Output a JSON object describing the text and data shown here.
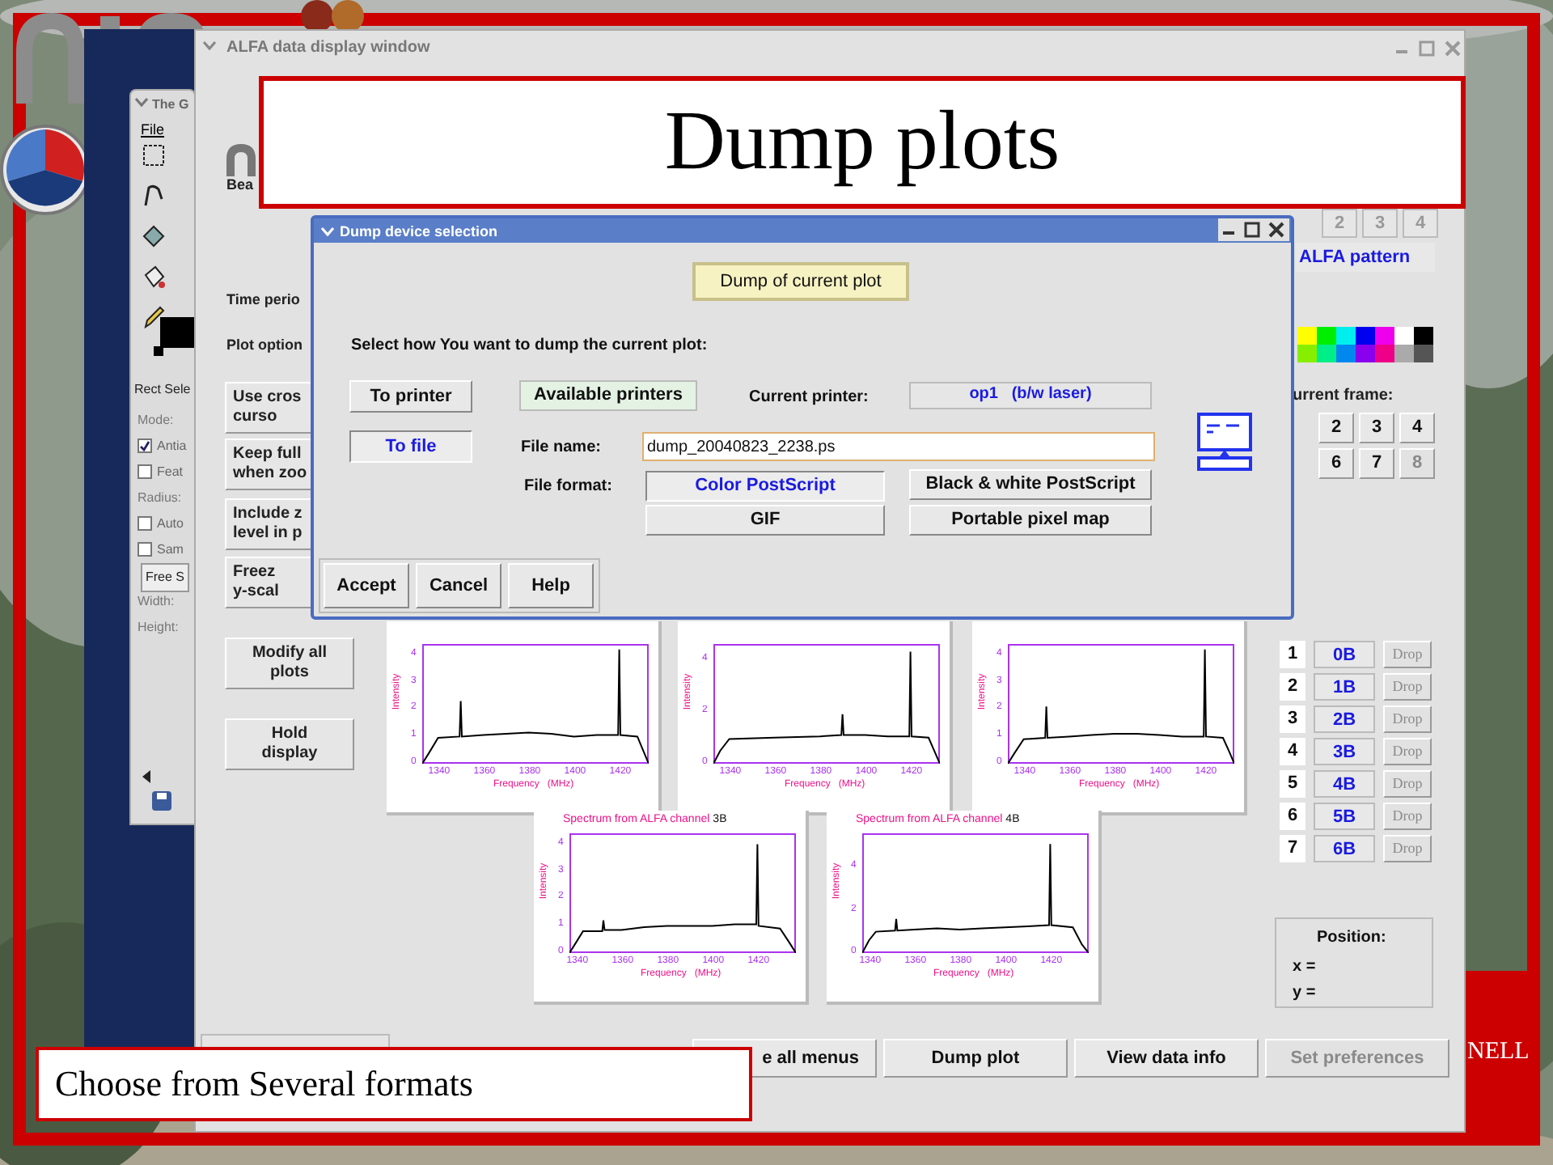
{
  "slide": {
    "title": "Dump plots",
    "caption": "Choose from Several formats",
    "corner_text": "NELL"
  },
  "toolbox": {
    "title": "The G",
    "menu": [
      "File"
    ],
    "panel_title": "Rect Sele",
    "options": [
      {
        "kind": "label",
        "label": "Mode:"
      },
      {
        "kind": "checkbox",
        "label": "Antia",
        "checked": true
      },
      {
        "kind": "checkbox",
        "label": "Feat",
        "checked": false
      },
      {
        "kind": "label",
        "label": "Radius:"
      },
      {
        "kind": "checkbox",
        "label": "Auto",
        "checked": false
      },
      {
        "kind": "checkbox",
        "label": "Sam",
        "checked": false
      },
      {
        "kind": "dropdown",
        "label": "Free S"
      },
      {
        "kind": "label",
        "label": "Width:"
      },
      {
        "kind": "label",
        "label": "Height:"
      }
    ]
  },
  "main_window": {
    "title": "ALFA data display window",
    "labels": [
      "Bea",
      "Time perio",
      "Plot option"
    ],
    "side_buttons": [
      "Use cros\ncurso",
      "Keep full\nwhen zoo",
      "Include z\nlevel in p",
      "Freez\ny-scal",
      "Modify all\nplots",
      "Hold\ndisplay"
    ],
    "beam_buttons": [
      "2",
      "3",
      "4"
    ],
    "pattern_button": "ALFA pattern",
    "frame_label": "urrent frame:",
    "frame_buttons": [
      {
        "label": "2",
        "disabled": false
      },
      {
        "label": "3",
        "disabled": false
      },
      {
        "label": "4",
        "disabled": false
      },
      {
        "label": "6",
        "disabled": false
      },
      {
        "label": "7",
        "disabled": false
      },
      {
        "label": "8",
        "disabled": true
      }
    ],
    "channels": [
      {
        "number": "1",
        "beam": "0B",
        "drop": "Drop",
        "drop_disabled": true
      },
      {
        "number": "2",
        "beam": "1B",
        "drop": "Drop",
        "drop_disabled": true
      },
      {
        "number": "3",
        "beam": "2B",
        "drop": "Drop",
        "drop_disabled": true
      },
      {
        "number": "4",
        "beam": "3B",
        "drop": "Drop",
        "drop_disabled": true
      },
      {
        "number": "5",
        "beam": "4B",
        "drop": "Drop",
        "drop_disabled": true
      },
      {
        "number": "6",
        "beam": "5B",
        "drop": "Drop",
        "drop_disabled": true
      },
      {
        "number": "7",
        "beam": "6B",
        "drop": "Drop",
        "drop_disabled": true
      }
    ],
    "position": {
      "title": "Position:",
      "x": "x =",
      "y": "y ="
    },
    "bottom_buttons": [
      {
        "label": "e all menus",
        "disabled": false
      },
      {
        "label": "Dump plot",
        "disabled": false
      },
      {
        "label": "View data info",
        "disabled": false
      },
      {
        "label": "Set preferences",
        "disabled": true
      }
    ],
    "plots": [
      {
        "chart_data": {
          "type": "line",
          "xlabel": "Frequency   (MHz)",
          "ylabel": "Intensity",
          "xlim": [
            1333,
            1433
          ],
          "ylim": [
            0,
            4.4
          ],
          "xticks": [
            1340,
            1360,
            1380,
            1400,
            1420
          ],
          "yticks": [
            0,
            1,
            2,
            3,
            4
          ],
          "x": [
            1333,
            1336,
            1340,
            1349.5,
            1350,
            1350.5,
            1360,
            1370,
            1380,
            1390,
            1400,
            1410,
            1419.5,
            1420,
            1420.5,
            1428,
            1431,
            1433
          ],
          "series": [
            {
              "color": "#000000",
              "values": [
                0,
                0.4,
                0.95,
                1.0,
                2.3,
                1.0,
                1.05,
                1.1,
                1.15,
                1.1,
                1.0,
                1.05,
                1.05,
                4.2,
                1.05,
                1.0,
                0.4,
                0
              ]
            }
          ]
        }
      },
      {
        "chart_data": {
          "type": "line",
          "xlabel": "Frequency   (MHz)",
          "ylabel": "Intensity",
          "xlim": [
            1333,
            1433
          ],
          "ylim": [
            0,
            4.6
          ],
          "xticks": [
            1340,
            1360,
            1380,
            1400,
            1420
          ],
          "yticks": [
            0,
            2,
            4
          ],
          "x": [
            1333,
            1336,
            1340,
            1360,
            1380,
            1389.5,
            1390,
            1390.5,
            1400,
            1410,
            1419.5,
            1420,
            1420.5,
            1428,
            1431,
            1433
          ],
          "series": [
            {
              "color": "#000000",
              "values": [
                0,
                0.5,
                0.95,
                1.0,
                1.05,
                1.1,
                1.9,
                1.1,
                1.1,
                1.05,
                1.05,
                4.3,
                1.05,
                1.0,
                0.4,
                0
              ]
            }
          ]
        }
      },
      {
        "chart_data": {
          "type": "line",
          "xlabel": "Frequency   (MHz)",
          "ylabel": "Intensity",
          "xlim": [
            1333,
            1433
          ],
          "ylim": [
            0,
            4.4
          ],
          "xticks": [
            1340,
            1360,
            1380,
            1400,
            1420
          ],
          "yticks": [
            0,
            1,
            2,
            3,
            4
          ],
          "x": [
            1333,
            1336,
            1340,
            1349.5,
            1350,
            1350.5,
            1360,
            1370,
            1380,
            1390,
            1400,
            1410,
            1419.5,
            1420,
            1420.5,
            1428,
            1431,
            1433
          ],
          "series": [
            {
              "color": "#000000",
              "values": [
                0,
                0.4,
                0.9,
                0.95,
                2.1,
                0.95,
                1.0,
                1.05,
                1.1,
                1.1,
                1.05,
                1.0,
                1.0,
                4.2,
                1.0,
                0.95,
                0.4,
                0
              ]
            }
          ]
        }
      },
      {
        "title": "Spectrum from ALFA channel",
        "channel": "3B",
        "chart_data": {
          "type": "line",
          "xlabel": "Frequency   (MHz)",
          "ylabel": "Intensity",
          "xlim": [
            1337,
            1437
          ],
          "ylim": [
            0,
            4.4
          ],
          "xticks": [
            1340,
            1360,
            1380,
            1400,
            1420
          ],
          "yticks": [
            0,
            1,
            2,
            3,
            4
          ],
          "x": [
            1337,
            1340,
            1343,
            1351.5,
            1352,
            1352.5,
            1360,
            1370,
            1380,
            1390,
            1400,
            1410,
            1419.5,
            1420,
            1420.5,
            1430,
            1434,
            1437
          ],
          "series": [
            {
              "color": "#000000",
              "values": [
                0,
                0.4,
                0.8,
                0.8,
                1.2,
                0.85,
                0.85,
                0.95,
                1.0,
                1.0,
                1.0,
                1.05,
                1.05,
                4.0,
                1.0,
                0.9,
                0.4,
                0
              ]
            }
          ]
        }
      },
      {
        "title": "Spectrum from ALFA channel",
        "channel": "4B",
        "chart_data": {
          "type": "line",
          "xlabel": "Frequency   (MHz)",
          "ylabel": "Intensity",
          "xlim": [
            1337,
            1437
          ],
          "ylim": [
            0,
            5.6
          ],
          "xticks": [
            1340,
            1360,
            1380,
            1400,
            1420
          ],
          "yticks": [
            0,
            2,
            4
          ],
          "x": [
            1337,
            1340,
            1343,
            1351.5,
            1352,
            1352.5,
            1360,
            1370,
            1380,
            1390,
            1400,
            1410,
            1419.5,
            1420,
            1420.5,
            1430,
            1434,
            1437
          ],
          "series": [
            {
              "color": "#000000",
              "values": [
                0,
                0.6,
                1.0,
                1.05,
                1.6,
                1.05,
                1.1,
                1.15,
                1.1,
                1.15,
                1.2,
                1.25,
                1.3,
                5.1,
                1.3,
                1.2,
                0.4,
                0
              ]
            }
          ]
        }
      }
    ]
  },
  "dialog": {
    "title": "Dump device selection",
    "dump_button": "Dump of current plot",
    "instruction": "Select how You want to dump the current plot:",
    "targets": [
      {
        "label": "To printer",
        "selected": false
      },
      {
        "label": "To file",
        "selected": true
      }
    ],
    "printers_button": "Available printers",
    "printer_label": "Current printer:",
    "printer": "op1   (b/w laser)",
    "file_label": "File name:",
    "file_name": "dump_20040823_2238.ps",
    "format_label": "File format:",
    "formats": [
      {
        "label": "Color PostScript",
        "selected": true
      },
      {
        "label": "Black & white PostScript",
        "selected": false
      },
      {
        "label": "GIF",
        "selected": false
      },
      {
        "label": "Portable pixel map",
        "selected": false
      }
    ],
    "actions": [
      "Accept",
      "Cancel",
      "Help"
    ]
  }
}
